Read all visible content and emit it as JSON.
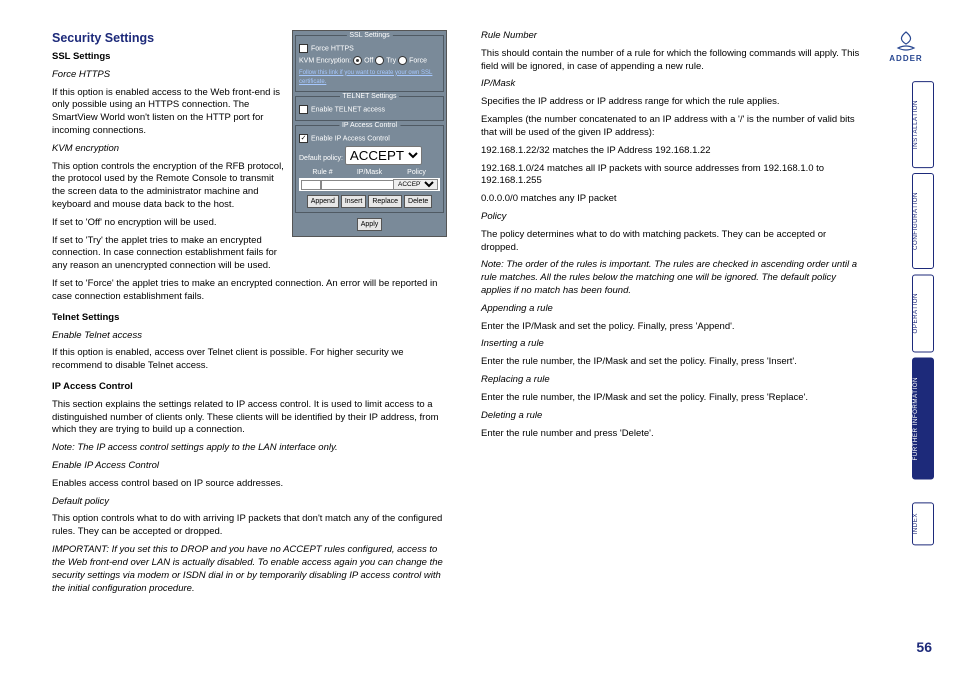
{
  "title": "Security Settings",
  "ssl": {
    "heading": "SSL Settings",
    "force_https_label": "Force HTTPS",
    "force_https_body": "If this option is enabled access to the Web front-end is only possible using an HTTPS connection. The SmartView World won't listen on the HTTP port for incoming connections.",
    "kvm_label": "KVM encryption",
    "kvm_body1": "This option controls the encryption of the RFB protocol, the protocol used by the Remote Console to transmit the screen data to the administrator machine and keyboard and mouse data back to the host.",
    "kvm_body2": "If set to 'Off' no encryption will be used.",
    "kvm_body3": "If set to 'Try' the applet tries to make an encrypted connection. In case connection establishment fails for any reason an unencrypted connection will be used.",
    "kvm_body4": "If set to 'Force' the applet tries to make an encrypted connection. An error will be reported in case connection establishment fails."
  },
  "telnet": {
    "heading": "Telnet Settings",
    "enable_label": "Enable Telnet access",
    "enable_body": "If this option is enabled, access over Telnet client is possible. For higher security we recommend to disable Telnet access."
  },
  "ipac": {
    "heading": "IP Access Control",
    "intro": "This section explains the settings related to IP access control. It is used to limit access to a distinguished number of clients only. These clients will be identified by their IP address, from which they are trying to build up a connection.",
    "note1": "Note: The IP access control settings apply to the LAN interface only.",
    "enable_label": "Enable IP Access Control",
    "enable_body": "Enables access control based on IP source addresses.",
    "default_label": "Default policy",
    "default_body": "This option controls what to do with arriving IP packets that don't match any of the configured rules. They can be accepted or dropped.",
    "important": "IMPORTANT: If you set this to DROP and you have no ACCEPT rules configured, access to the Web front-end over LAN is actually disabled. To enable access again you can change the security settings via modem or ISDN dial in or by temporarily disabling IP access control with the initial configuration procedure."
  },
  "right": {
    "rule_label": "Rule Number",
    "rule_body": "This should contain the number of a rule for which the following commands will apply. This field will be ignored, in case of appending a new rule.",
    "ipmask_label": "IP/Mask",
    "ipmask_body": "Specifies the IP address or IP address range for which the rule applies.",
    "ipmask_ex_intro": "Examples (the number concatenated to an IP address with a '/' is the number of valid bits that will be used of the given IP address):",
    "ex1": "192.168.1.22/32 matches the IP Address 192.168.1.22",
    "ex2": "192.168.1.0/24 matches all IP packets with source addresses from 192.168.1.0 to 192.168.1.255",
    "ex3": "0.0.0.0/0 matches any IP packet",
    "policy_label": "Policy",
    "policy_body": "The policy determines what to do with matching packets. They can be accepted or dropped.",
    "policy_note": "Note: The order of the rules is important. The rules are checked in ascending order until a rule matches. All the rules below the matching one will be ignored. The default policy applies if no match has been found.",
    "append_label": "Appending a rule",
    "append_body": "Enter the IP/Mask and set the policy. Finally, press 'Append'.",
    "insert_label": "Inserting a rule",
    "insert_body": "Enter the rule number, the IP/Mask and set the policy. Finally, press 'Insert'.",
    "replace_label": "Replacing a rule",
    "replace_body": "Enter the rule number, the IP/Mask and set the policy. Finally, press 'Replace'.",
    "delete_label": "Deleting a rule",
    "delete_body": "Enter the rule number and press 'Delete'."
  },
  "dialog": {
    "ssl_title": "SSL Settings",
    "force_https": "Force HTTPS",
    "kvm_enc": "KVM Encryption:",
    "off": "Off",
    "try": "Try",
    "force": "Force",
    "cert_link": "Follow this link if you want to create your own SSL certificate.",
    "telnet_title": "TELNET Settings",
    "enable_telnet": "Enable TELNET access",
    "ipac_title": "IP Access Control",
    "enable_ipac": "Enable IP Access Control",
    "default_policy": "Default policy:",
    "accept": "ACCEPT",
    "col_rule": "Rule #",
    "col_ipmask": "IP/Mask",
    "col_policy": "Policy",
    "append": "Append",
    "insert": "Insert",
    "replace": "Replace",
    "delete": "Delete",
    "apply": "Apply"
  },
  "sidebar": {
    "brand": "ADDER",
    "tabs": [
      "INSTALLATION",
      "CONFIGURATION",
      "OPERATION",
      "FURTHER\nINFORMATION",
      "INDEX"
    ]
  },
  "page_number": "56"
}
